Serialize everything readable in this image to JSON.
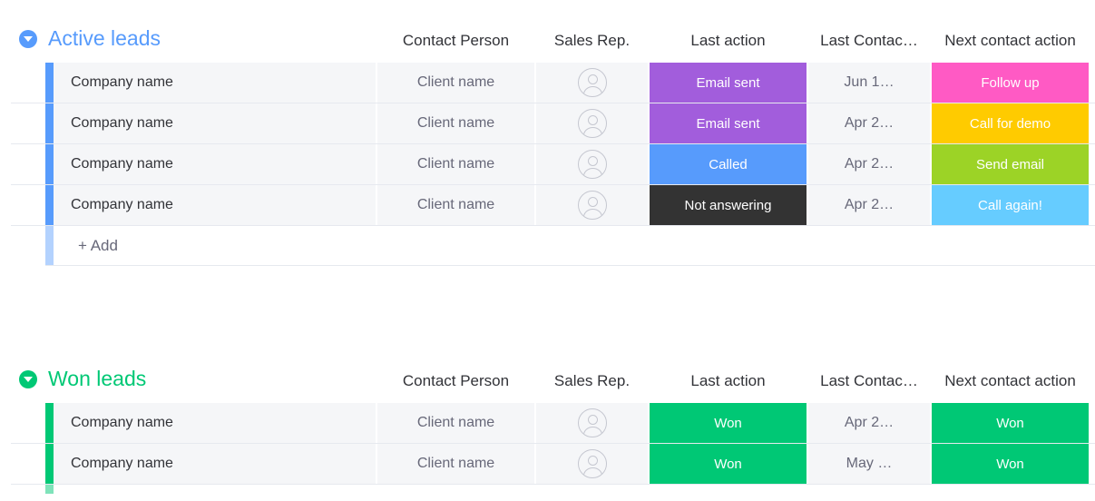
{
  "columns": {
    "contact": "Contact Person",
    "rep": "Sales Rep.",
    "last_action": "Last action",
    "last_contacted": "Last Contac…",
    "next_action": "Next contact action"
  },
  "colors": {
    "active_group": "#579bfc",
    "won_group": "#00c875",
    "purple": "#a25ddc",
    "pink": "#ff5ac4",
    "yellow": "#ffcb00",
    "blue": "#579bfc",
    "dark": "#333333",
    "lime": "#9cd326",
    "sky": "#66ccff",
    "green": "#00c875"
  },
  "groups": [
    {
      "title": "Active leads",
      "add_label": "+ Add",
      "rows": [
        {
          "name": "Company name",
          "contact": "Client name",
          "last_action": "Email sent",
          "last_color": "#a25ddc",
          "date": "Jun 1…",
          "next_action": "Follow up",
          "next_color": "#ff5ac4"
        },
        {
          "name": "Company name",
          "contact": "Client name",
          "last_action": "Email sent",
          "last_color": "#a25ddc",
          "date": "Apr 2…",
          "next_action": "Call for demo",
          "next_color": "#ffcb00"
        },
        {
          "name": "Company name",
          "contact": "Client name",
          "last_action": "Called",
          "last_color": "#579bfc",
          "date": "Apr 2…",
          "next_action": "Send email",
          "next_color": "#9cd326"
        },
        {
          "name": "Company name",
          "contact": "Client name",
          "last_action": "Not answering",
          "last_color": "#333333",
          "date": "Apr 2…",
          "next_action": "Call again!",
          "next_color": "#66ccff"
        }
      ]
    },
    {
      "title": "Won leads",
      "rows": [
        {
          "name": "Company name",
          "contact": "Client name",
          "last_action": "Won",
          "last_color": "#00c875",
          "date": "Apr 2…",
          "next_action": "Won",
          "next_color": "#00c875"
        },
        {
          "name": "Company name",
          "contact": "Client name",
          "last_action": "Won",
          "last_color": "#00c875",
          "date": "May …",
          "next_action": "Won",
          "next_color": "#00c875"
        }
      ]
    }
  ]
}
